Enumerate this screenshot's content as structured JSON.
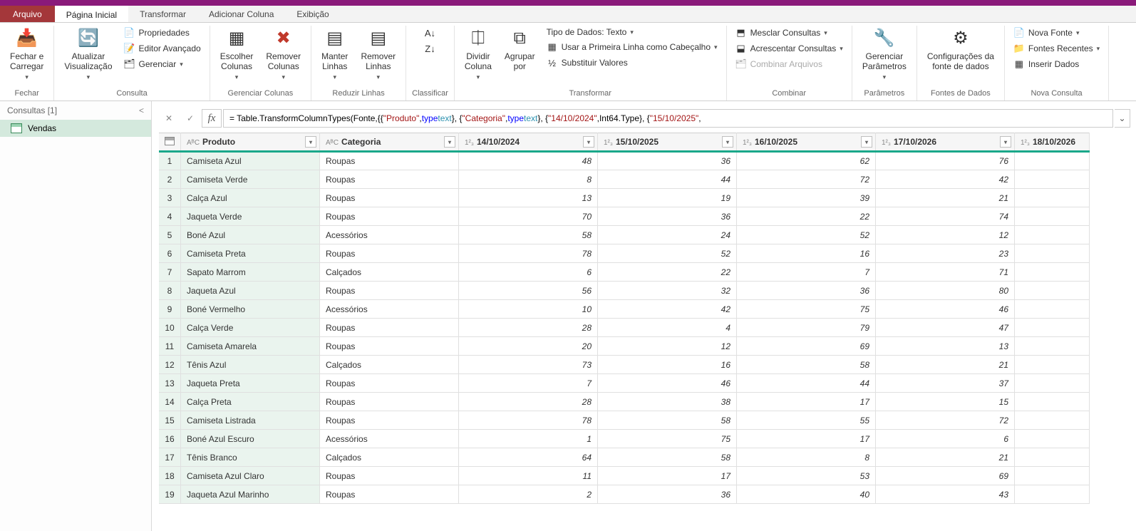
{
  "tabs": {
    "file": "Arquivo",
    "home": "Página Inicial",
    "transform": "Transformar",
    "addcol": "Adicionar Coluna",
    "view": "Exibição"
  },
  "ribbon": {
    "close": {
      "btn": "Fechar e\nCarregar",
      "label": "Fechar"
    },
    "query": {
      "refresh": "Atualizar\nVisualização",
      "props": "Propriedades",
      "adv": "Editor Avançado",
      "manage": "Gerenciar",
      "label": "Consulta"
    },
    "cols": {
      "choose": "Escolher\nColunas",
      "remove": "Remover\nColunas",
      "label": "Gerenciar Colunas"
    },
    "rows": {
      "keep": "Manter\nLinhas",
      "remove": "Remover\nLinhas",
      "label": "Reduzir Linhas"
    },
    "sort": {
      "label": "Classificar"
    },
    "transform": {
      "split": "Dividir\nColuna",
      "group": "Agrupar\npor",
      "dtype": "Tipo de Dados: Texto",
      "firstrow": "Usar a Primeira Linha como Cabeçalho",
      "replace": "Substituir Valores",
      "label": "Transformar"
    },
    "combine": {
      "merge": "Mesclar Consultas",
      "append": "Acrescentar Consultas",
      "files": "Combinar Arquivos",
      "label": "Combinar"
    },
    "params": {
      "btn": "Gerenciar\nParâmetros",
      "label": "Parâmetros"
    },
    "datasrc": {
      "btn": "Configurações da\nfonte de dados",
      "label": "Fontes de Dados"
    },
    "newq": {
      "new": "Nova Fonte",
      "recent": "Fontes Recentes",
      "enter": "Inserir Dados",
      "label": "Nova Consulta"
    }
  },
  "sidebar": {
    "header": "Consultas [1]",
    "item": "Vendas"
  },
  "formula": {
    "prefix": "= Table.TransformColumnTypes(Fonte,{{",
    "p1": "\"Produto\"",
    "p2": "type",
    "p3": "text",
    "c1": "\"Categoria\"",
    "d1": "\"14/10/2024\"",
    "d1t": "Int64.Type",
    "d2": "\"15/10/2025\""
  },
  "columns": [
    "Produto",
    "Categoria",
    "14/10/2024",
    "15/10/2025",
    "16/10/2025",
    "17/10/2026",
    "18/10/2026"
  ],
  "dtype_text": "AᴮC",
  "dtype_num": "1²₃",
  "rows": [
    {
      "n": 1,
      "p": "Camiseta Azul",
      "c": "Roupas",
      "v": [
        48,
        36,
        62,
        76
      ]
    },
    {
      "n": 2,
      "p": "Camiseta Verde",
      "c": "Roupas",
      "v": [
        8,
        44,
        72,
        42
      ]
    },
    {
      "n": 3,
      "p": "Calça Azul",
      "c": "Roupas",
      "v": [
        13,
        19,
        39,
        21
      ]
    },
    {
      "n": 4,
      "p": "Jaqueta Verde",
      "c": "Roupas",
      "v": [
        70,
        36,
        22,
        74
      ]
    },
    {
      "n": 5,
      "p": "Boné Azul",
      "c": "Acessórios",
      "v": [
        58,
        24,
        52,
        12
      ]
    },
    {
      "n": 6,
      "p": "Camiseta Preta",
      "c": "Roupas",
      "v": [
        78,
        52,
        16,
        23
      ]
    },
    {
      "n": 7,
      "p": "Sapato Marrom",
      "c": "Calçados",
      "v": [
        6,
        22,
        7,
        71
      ]
    },
    {
      "n": 8,
      "p": "Jaqueta Azul",
      "c": "Roupas",
      "v": [
        56,
        32,
        36,
        80
      ]
    },
    {
      "n": 9,
      "p": "Boné Vermelho",
      "c": "Acessórios",
      "v": [
        10,
        42,
        75,
        46
      ]
    },
    {
      "n": 10,
      "p": "Calça Verde",
      "c": "Roupas",
      "v": [
        28,
        4,
        79,
        47
      ]
    },
    {
      "n": 11,
      "p": "Camiseta Amarela",
      "c": "Roupas",
      "v": [
        20,
        12,
        69,
        13
      ]
    },
    {
      "n": 12,
      "p": "Tênis Azul",
      "c": "Calçados",
      "v": [
        73,
        16,
        58,
        21
      ]
    },
    {
      "n": 13,
      "p": "Jaqueta Preta",
      "c": "Roupas",
      "v": [
        7,
        46,
        44,
        37
      ]
    },
    {
      "n": 14,
      "p": "Calça Preta",
      "c": "Roupas",
      "v": [
        28,
        38,
        17,
        15
      ]
    },
    {
      "n": 15,
      "p": "Camiseta Listrada",
      "c": "Roupas",
      "v": [
        78,
        58,
        55,
        72
      ]
    },
    {
      "n": 16,
      "p": "Boné Azul Escuro",
      "c": "Acessórios",
      "v": [
        1,
        75,
        17,
        6
      ]
    },
    {
      "n": 17,
      "p": "Tênis Branco",
      "c": "Calçados",
      "v": [
        64,
        58,
        8,
        21
      ]
    },
    {
      "n": 18,
      "p": "Camiseta Azul Claro",
      "c": "Roupas",
      "v": [
        11,
        17,
        53,
        69
      ]
    },
    {
      "n": 19,
      "p": "Jaqueta Azul Marinho",
      "c": "Roupas",
      "v": [
        2,
        36,
        40,
        43
      ]
    }
  ]
}
